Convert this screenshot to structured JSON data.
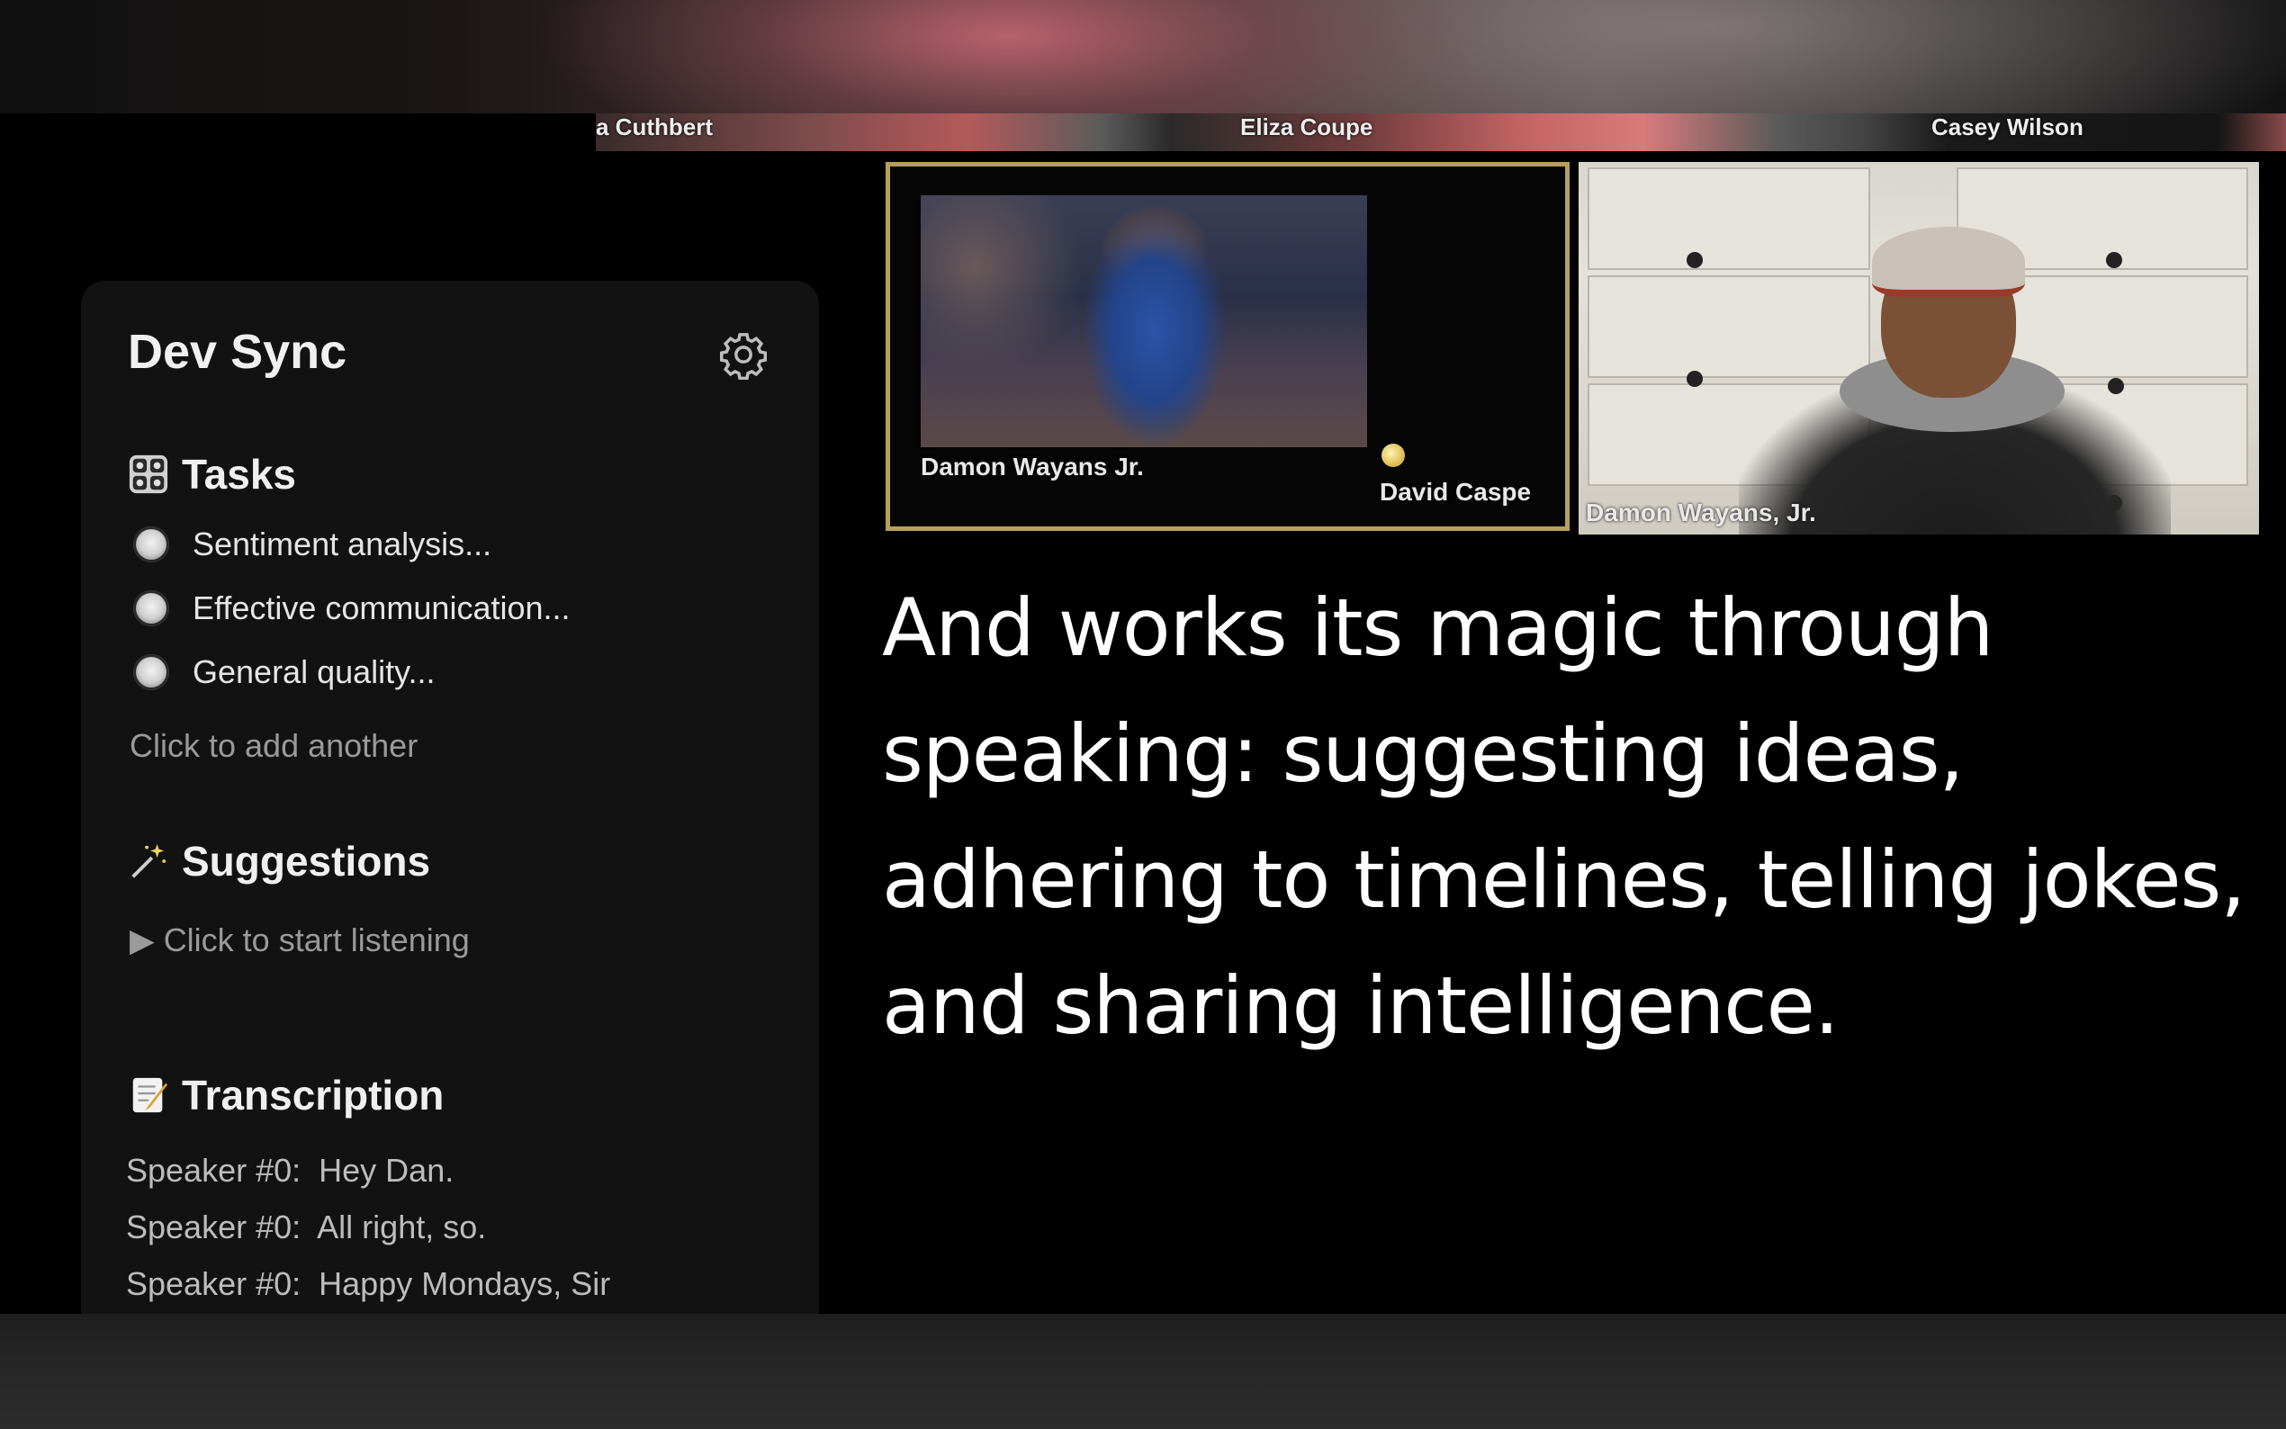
{
  "strip": {
    "names": [
      "a Cuthbert",
      "Eliza Coupe",
      "Casey Wilson"
    ]
  },
  "sidebar": {
    "title": "Dev Sync",
    "settings_icon": "gear-icon",
    "tasks": {
      "heading": "Tasks",
      "icon": "control-knobs-icon",
      "items": [
        {
          "label": "Sentiment analysis..."
        },
        {
          "label": "Effective communication..."
        },
        {
          "label": "General quality..."
        }
      ],
      "add_label": "Click to add another"
    },
    "suggestions": {
      "heading": "Suggestions",
      "icon": "magic-wand-icon",
      "start_label": "▶ Click to start listening"
    },
    "transcription": {
      "heading": "Transcription",
      "icon": "memo-icon",
      "lines": [
        {
          "speaker": "Speaker #0:",
          "text": "Hey Dan."
        },
        {
          "speaker": "Speaker #0:",
          "text": "All right, so."
        },
        {
          "speaker": "Speaker #0:",
          "text": "Happy Mondays, Sir"
        }
      ]
    }
  },
  "video": {
    "tile1": {
      "label_left": "Damon Wayans Jr.",
      "label_right": "David Caspe"
    },
    "tile2": {
      "label": "Damon Wayans, Jr."
    }
  },
  "caption": {
    "text": "And works its magic through speaking: suggesting ideas, adhering to timelines, telling jokes, and sharing intelligence."
  },
  "colors": {
    "panel_bg": "#121212",
    "active_speaker_border": "#b8a05a",
    "caption_text": "#ffffff"
  }
}
